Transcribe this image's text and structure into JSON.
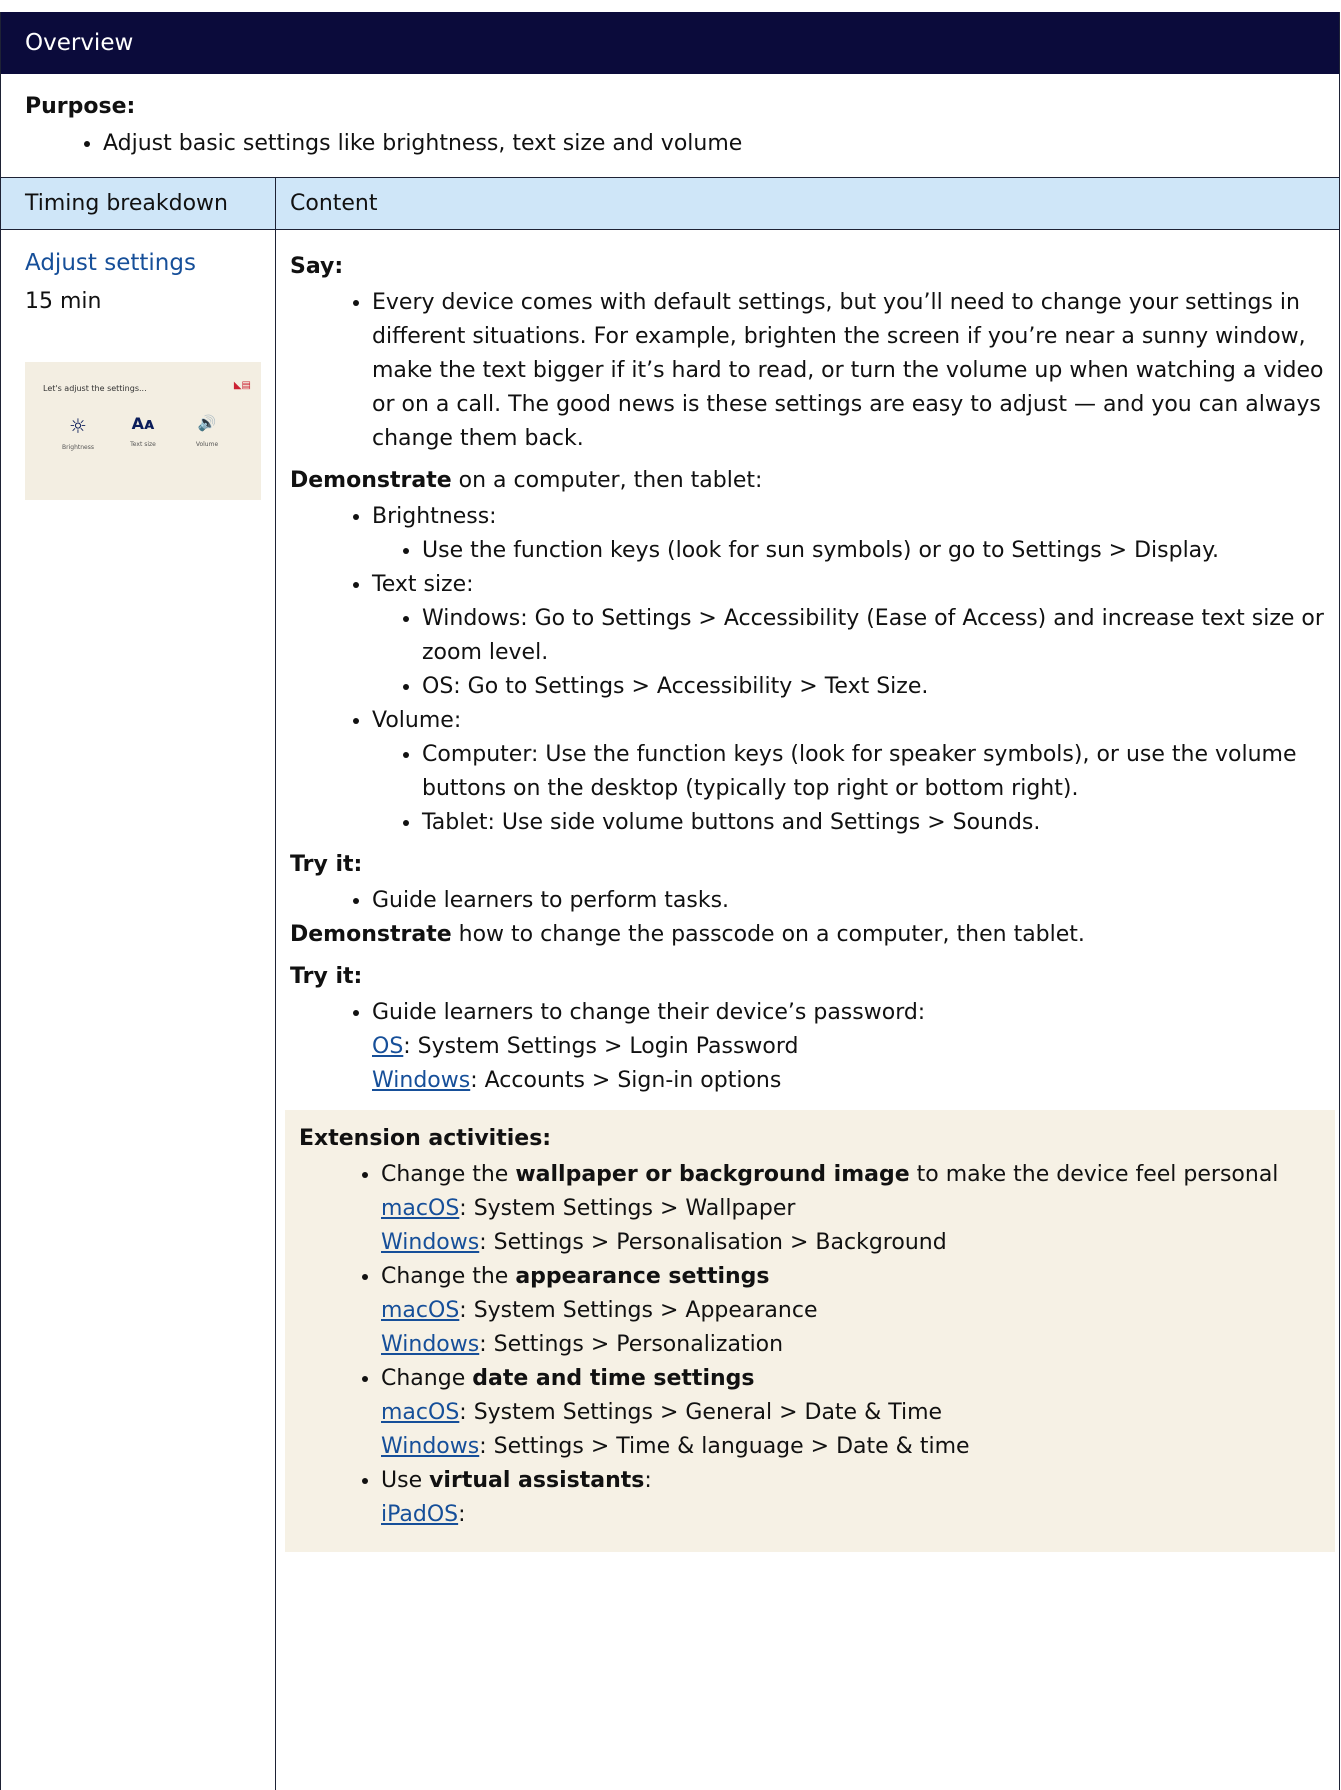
{
  "overview": {
    "title": "Overview"
  },
  "purpose": {
    "label": "Purpose:",
    "items": [
      "Adjust basic settings like brightness, text size and volume"
    ]
  },
  "columns": {
    "timing": "Timing breakdown",
    "content": "Content"
  },
  "section": {
    "title": "Adjust settings",
    "duration": "15 min",
    "thumb": {
      "title": "Let's adjust the settings...",
      "icons": [
        {
          "glyph": "☼",
          "label": "Brightness"
        },
        {
          "glyph": "Aᴀ",
          "label": "Text size"
        },
        {
          "glyph": "🔊",
          "label": "Volume"
        }
      ]
    }
  },
  "content": {
    "say_label": "Say:",
    "say_text": "Every device comes with default settings, but you’ll need to change your settings in different situations. For example, brighten the screen if you’re near a sunny window, make the text bigger if it’s hard to read, or turn the volume up when watching a video or on a call. The good news is these settings are easy to adjust — and you can always change them back.",
    "demo1_bold": "Demonstrate",
    "demo1_rest": " on a computer, then tablet:",
    "brightness_label": "Brightness:",
    "brightness_item": "Use the function keys (look for sun symbols) or go to Settings > Display.",
    "textsize_label": "Text size:",
    "textsize_windows": "Windows: Go to Settings > Accessibility (Ease of Access) and increase text size or zoom level.",
    "textsize_os": "OS: Go to Settings > Accessibility > Text Size.",
    "volume_label": "Volume:",
    "volume_computer": "Computer: Use the function keys (look for speaker symbols), or use the volume buttons on the desktop (typically top right or bottom right).",
    "volume_tablet": "Tablet: Use side volume buttons and Settings > Sounds.",
    "tryit1_label": "Try it:",
    "tryit1_item": "Guide learners to perform tasks.",
    "demo2_bold": "Demonstrate",
    "demo2_rest": " how to change the passcode on a computer, then tablet.",
    "tryit2_label": "Try it:",
    "tryit2_item": "Guide learners to change their device’s password:",
    "pw_os_link": "OS",
    "pw_os_rest": ": System Settings > Login Password",
    "pw_win_link": "Windows",
    "pw_win_rest": ": Accounts > Sign-in options"
  },
  "extension": {
    "label": "Extension activities:",
    "wallpaper": {
      "pre": "Change the ",
      "bold": "wallpaper or background image",
      "post": " to make the device feel personal",
      "mac_link": "macOS",
      "mac_rest": ": System Settings > Wallpaper",
      "win_link": "Windows",
      "win_rest": ": Settings > Personalisation > Background"
    },
    "appearance": {
      "pre": "Change the ",
      "bold": "appearance settings",
      "mac_link": "macOS",
      "mac_rest": ": System Settings > Appearance",
      "win_link": "Windows",
      "win_rest": ": Settings > Personalization"
    },
    "datetime": {
      "pre": "Change ",
      "bold": "date and time settings",
      "mac_link": "macOS",
      "mac_rest": ": System Settings > General > Date & Time",
      "win_link": "Windows",
      "win_rest": ": Settings > Time & language > Date & time"
    },
    "assistants": {
      "pre": "Use ",
      "bold": "virtual assistants",
      "post": ":",
      "ipad_link": "iPadOS",
      "ipad_rest": ":"
    }
  }
}
